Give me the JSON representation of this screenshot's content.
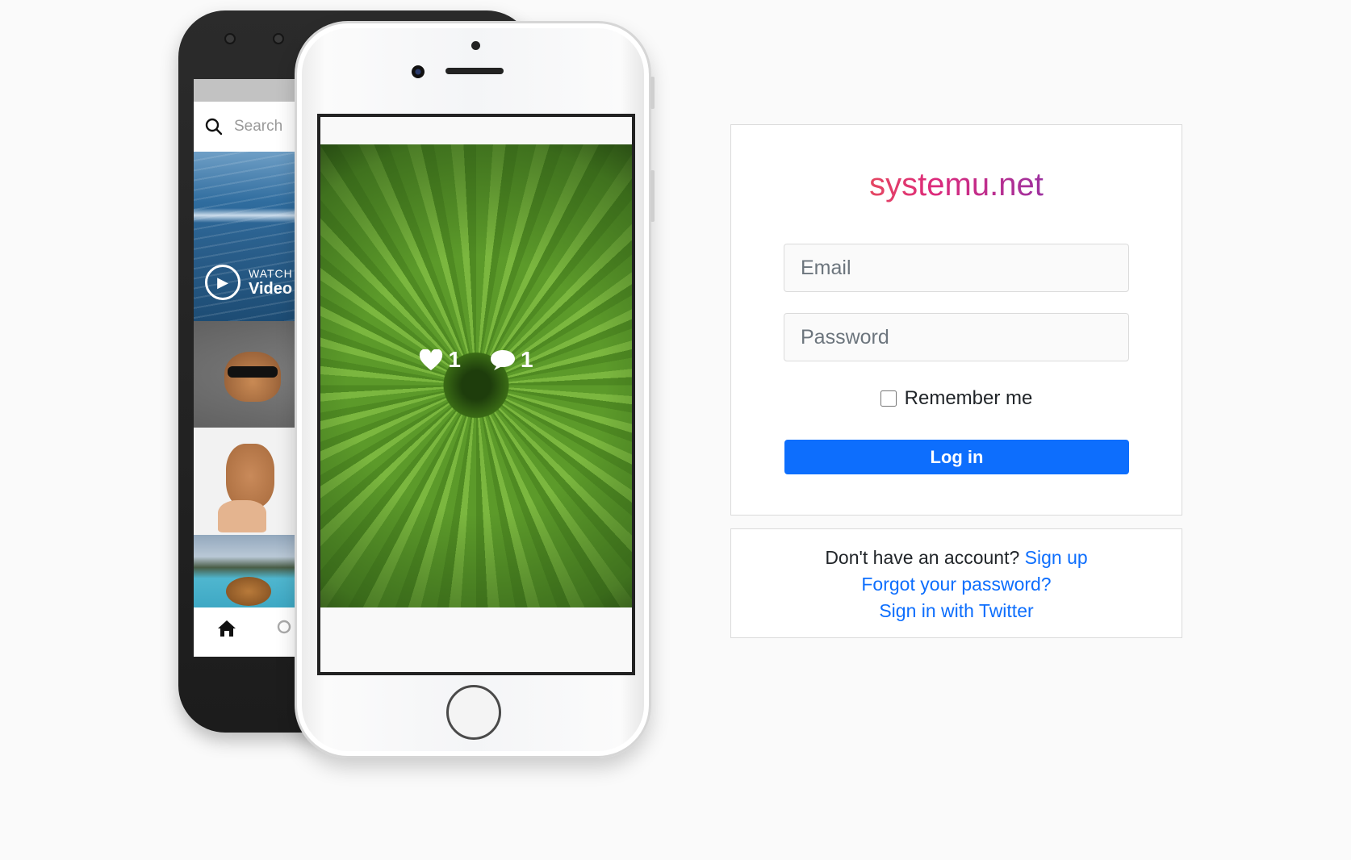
{
  "back_phone": {
    "search_placeholder": "Search",
    "watch_label": "WATCH",
    "video_label": "Video"
  },
  "front_phone": {
    "likes": "1",
    "comments": "1"
  },
  "login": {
    "logo": "systemu.net",
    "email_placeholder": "Email",
    "password_placeholder": "Password",
    "remember_label": "Remember me",
    "login_button": "Log in"
  },
  "links": {
    "no_account_text": "Don't have an account?",
    "sign_up": "Sign up",
    "forgot_password": "Forgot your password?",
    "twitter": "Sign in with Twitter"
  },
  "colors": {
    "primary": "#0d6efd",
    "background": "#fafafa",
    "border": "#dbdbdb"
  }
}
